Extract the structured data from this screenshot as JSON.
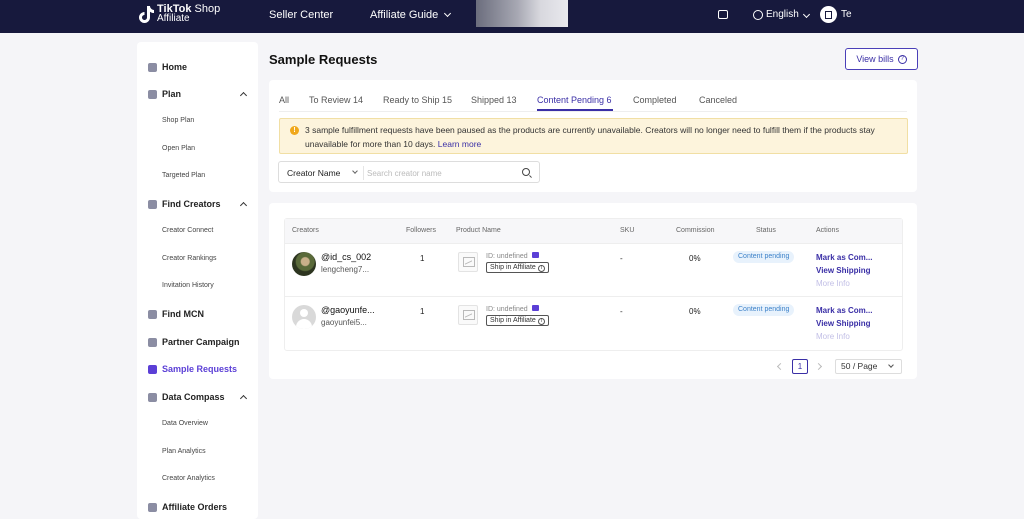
{
  "topnav": {
    "brand_line1": "TikTok",
    "brand_line1_b": "Shop",
    "brand_line2": "Affiliate",
    "seller_center": "Seller Center",
    "affiliate_guide": "Affiliate Guide",
    "language": "English",
    "username": "Te"
  },
  "sidebar": {
    "home": "Home",
    "plan": "Plan",
    "shop_plan": "Shop Plan",
    "open_plan": "Open Plan",
    "targeted_plan": "Targeted Plan",
    "find_creators": "Find Creators",
    "creator_connect": "Creator Connect",
    "creator_rankings": "Creator Rankings",
    "invitation_history": "Invitation History",
    "find_mcn": "Find MCN",
    "partner_campaign": "Partner Campaign",
    "sample_requests": "Sample Requests",
    "data_compass": "Data Compass",
    "data_overview": "Data Overview",
    "plan_analytics": "Plan Analytics",
    "creator_analytics": "Creator Analytics",
    "affiliate_orders": "Affiliate Orders"
  },
  "page": {
    "title": "Sample Requests",
    "view_bills": "View bills"
  },
  "tabs": [
    "All",
    "To Review 14",
    "Ready to Ship 15",
    "Shipped 13",
    "Content Pending 6",
    "Completed",
    "Canceled"
  ],
  "banner": {
    "text": "3 sample fulfillment requests have been paused as the products are currently unavailable. Creators will no longer need to fulfill them if the products stay unavailable for more than 10 days.",
    "link": "Learn more"
  },
  "filter": {
    "select": "Creator Name",
    "placeholder": "Search creator name",
    "value": ""
  },
  "table": {
    "headers": [
      "Creators",
      "Followers",
      "Product Name",
      "SKU",
      "Commission",
      "Status",
      "Actions"
    ],
    "rows": [
      {
        "handle": "@id_cs_002",
        "name": "lengcheng7...",
        "followers": "1",
        "product_id": "ID: undefined",
        "ship_tag": "Ship in Affiliate",
        "sku": "-",
        "commission": "0%",
        "status": "Content pending",
        "action1": "Mark as Com...",
        "action2": "View Shipping",
        "action3": "More Info"
      },
      {
        "handle": "@gaoyunfe...",
        "name": "gaoyunfei5...",
        "followers": "1",
        "product_id": "ID: undefined",
        "ship_tag": "Ship in Affiliate",
        "sku": "-",
        "commission": "0%",
        "status": "Content pending",
        "action1": "Mark as Com...",
        "action2": "View Shipping",
        "action3": "More Info"
      }
    ]
  },
  "pagination": {
    "current_page": "1",
    "page_size": "50 / Page"
  }
}
